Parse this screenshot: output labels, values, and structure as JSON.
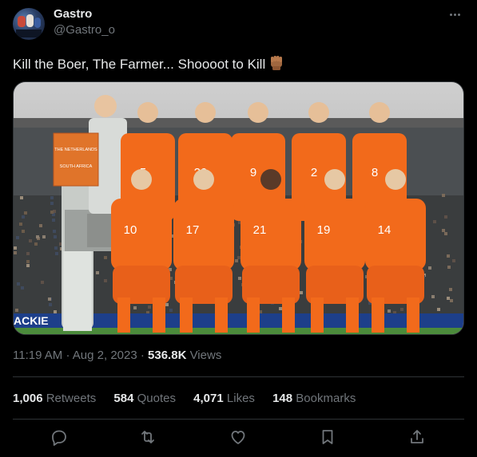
{
  "author": {
    "name": "Gastro",
    "handle": "@Gastro_o"
  },
  "tweet": {
    "text": "Kill the Boer, The Farmer... Shoooot to Kill",
    "emoji": "raised-fist-emoji"
  },
  "media": {
    "banner_text": "ACKIE",
    "sign_line1": "THE NETHERLANDS",
    "sign_line2": "SOUTH AFRICA",
    "back_numbers": [
      "5",
      "20",
      "9",
      "2",
      "8"
    ],
    "front_numbers": [
      "10",
      "17",
      "21",
      "19",
      "14"
    ]
  },
  "meta": {
    "time": "11:19 AM",
    "separator": "·",
    "date": "Aug 2, 2023",
    "views_count": "536.8K",
    "views_label": "Views"
  },
  "stats": {
    "retweets_count": "1,006",
    "retweets_label": "Retweets",
    "quotes_count": "584",
    "quotes_label": "Quotes",
    "likes_count": "4,071",
    "likes_label": "Likes",
    "bookmarks_count": "148",
    "bookmarks_label": "Bookmarks"
  },
  "actions": [
    "reply-icon",
    "retweet-icon",
    "like-icon",
    "bookmark-icon",
    "share-icon"
  ],
  "colors": {
    "background": "#000000",
    "text": "#e7e9ea",
    "muted": "#71767b",
    "divider": "#2f3336",
    "jersey_orange": "#f26a1b"
  }
}
